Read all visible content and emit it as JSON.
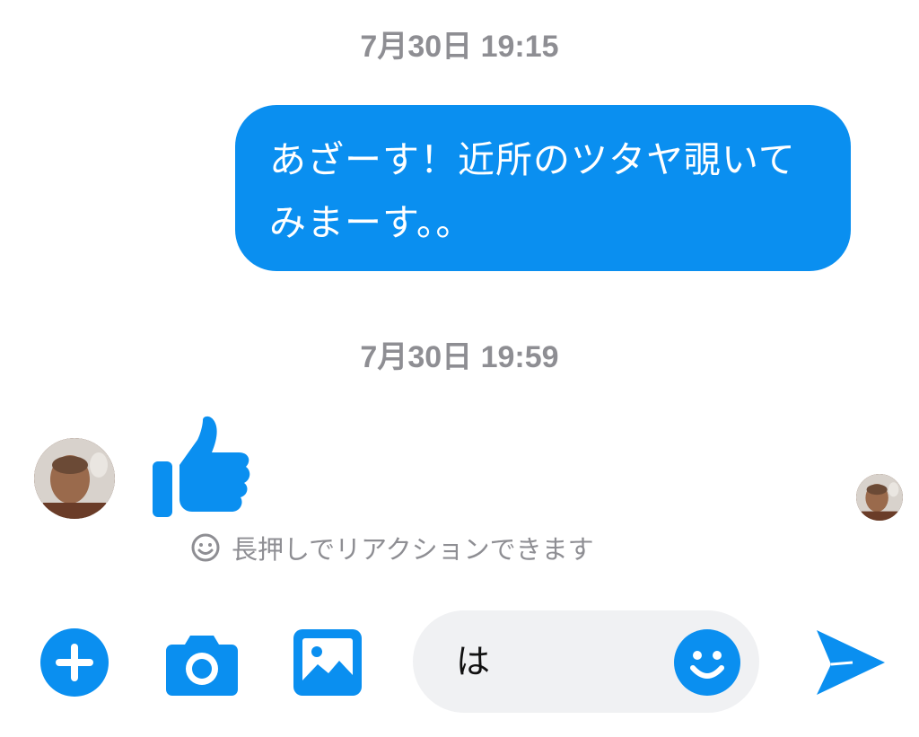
{
  "thread": {
    "messages": [
      {
        "timestamp": "7月30日 19:15",
        "text": "あざーす！近所のツタヤ覗いてみまーす。。"
      },
      {
        "timestamp": "7月30日 19:59",
        "sticker": "thumbs-up-icon"
      }
    ],
    "reaction_hint": "長押しでリアクションできます"
  },
  "composer": {
    "text": "は"
  },
  "colors": {
    "accent": "#0a8ff0",
    "timestamp": "#8e8e93",
    "composer_bg": "#f0f1f3"
  }
}
